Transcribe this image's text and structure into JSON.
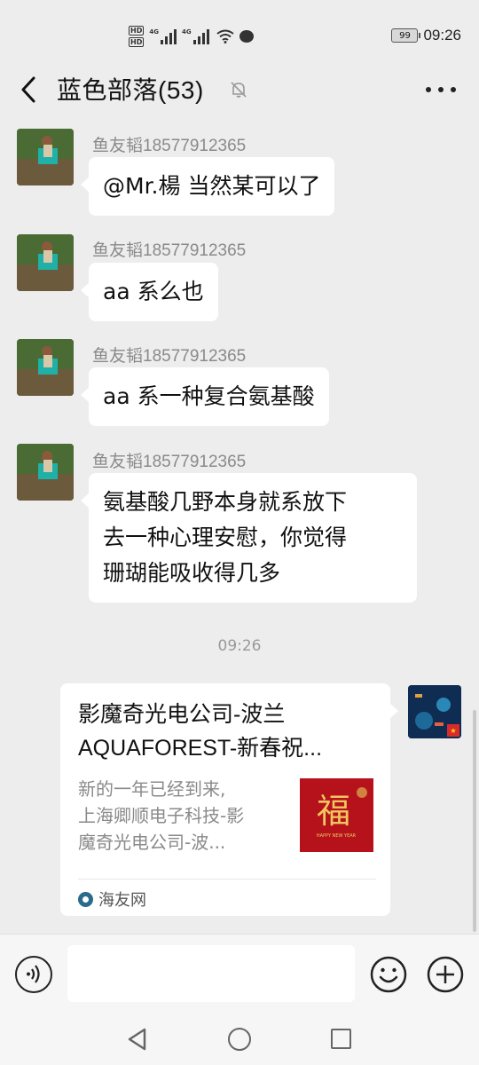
{
  "status_bar": {
    "time": "09:26",
    "battery": "99",
    "network_label": "4G",
    "hd_label": "HD"
  },
  "header": {
    "title": "蓝色部落(53)"
  },
  "messages": [
    {
      "sender": "鱼友韬18577912365",
      "text": "@Mr.楊  当然某可以了"
    },
    {
      "sender": "鱼友韬18577912365",
      "text": "aa 系么也"
    },
    {
      "sender": "鱼友韬18577912365",
      "text": "aa 系一种复合氨基酸"
    },
    {
      "sender": "鱼友韬18577912365",
      "text_lines": [
        "氨基酸几野本身就系放下",
        "去一种心理安慰，你觉得",
        "珊瑚能吸收得几多"
      ]
    }
  ],
  "timestamp": "09:26",
  "link_card": {
    "title_line1": "影魔奇光电公司-波兰",
    "title_line2": "AQUAFOREST-新春祝...",
    "desc_lines": [
      "新的一年已经到来,",
      "上海卿顺电子科技-影",
      "魔奇光电公司-波..."
    ],
    "source": "海友网",
    "thumb_char": "福",
    "thumb_caption": "HAPPY NEW YEAR"
  },
  "colors": {
    "background": "#ededed",
    "bubble": "#ffffff",
    "sender_text": "#8a8a8a",
    "thumb_red": "#b5121b"
  }
}
